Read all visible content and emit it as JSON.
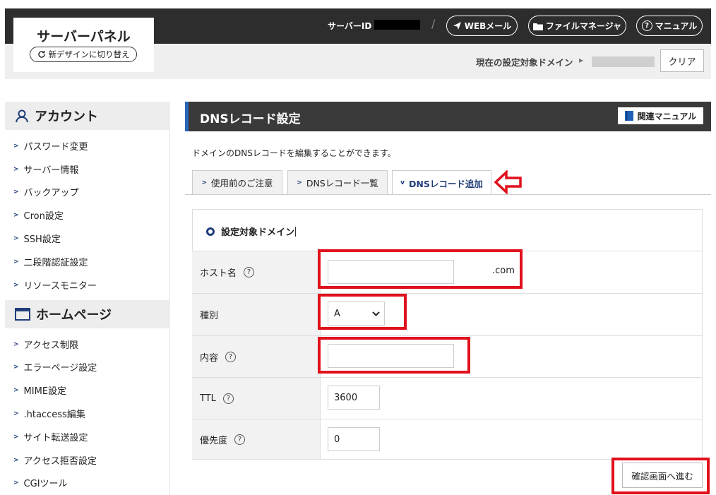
{
  "header": {
    "title": "サーバーパネル",
    "new_design_label": "新デザインに切り替え",
    "server_id_label": "サーバーID",
    "separator": "/",
    "webmail_label": "WEBメール",
    "file_manager_label": "ファイルマネージャ",
    "manual_label": "マニュアル",
    "current_domain_label": "現在の設定対象ドメイン",
    "clear_label": "クリア"
  },
  "sidebar": {
    "account": {
      "title": "アカウント",
      "items": [
        {
          "label": "パスワード変更"
        },
        {
          "label": "サーバー情報"
        },
        {
          "label": "バックアップ"
        },
        {
          "label": "Cron設定"
        },
        {
          "label": "SSH設定"
        },
        {
          "label": "二段階認証設定"
        },
        {
          "label": "リソースモニター"
        }
      ]
    },
    "homepage": {
      "title": "ホームページ",
      "items": [
        {
          "label": "アクセス制限"
        },
        {
          "label": "エラーページ設定"
        },
        {
          "label": "MIME設定"
        },
        {
          "label": ".htaccess編集"
        },
        {
          "label": "サイト転送設定"
        },
        {
          "label": "アクセス拒否設定"
        },
        {
          "label": "CGIツール"
        }
      ]
    }
  },
  "main": {
    "title": "DNSレコード設定",
    "related_manual_label": "関連マニュアル",
    "description": "ドメインのDNSレコードを編集することができます。",
    "tabs": [
      {
        "label": "使用前のご注意",
        "active": false
      },
      {
        "label": "DNSレコード一覧",
        "active": false
      },
      {
        "label": "DNSレコード追加",
        "active": true
      }
    ],
    "form": {
      "target_domain_label": "設定対象ドメイン",
      "fields": {
        "host": {
          "label": "ホスト名",
          "value": "",
          "suffix": ".com"
        },
        "type": {
          "label": "種別",
          "value": "A"
        },
        "content": {
          "label": "内容",
          "value": ""
        },
        "ttl": {
          "label": "TTL",
          "value": "3600"
        },
        "priority": {
          "label": "優先度",
          "value": "0"
        }
      },
      "confirm_label": "確認画面へ進む"
    }
  },
  "colors": {
    "accent": "#2a66b8",
    "highlight_red": "#e0101c",
    "header_dark": "#2d2d2d"
  }
}
